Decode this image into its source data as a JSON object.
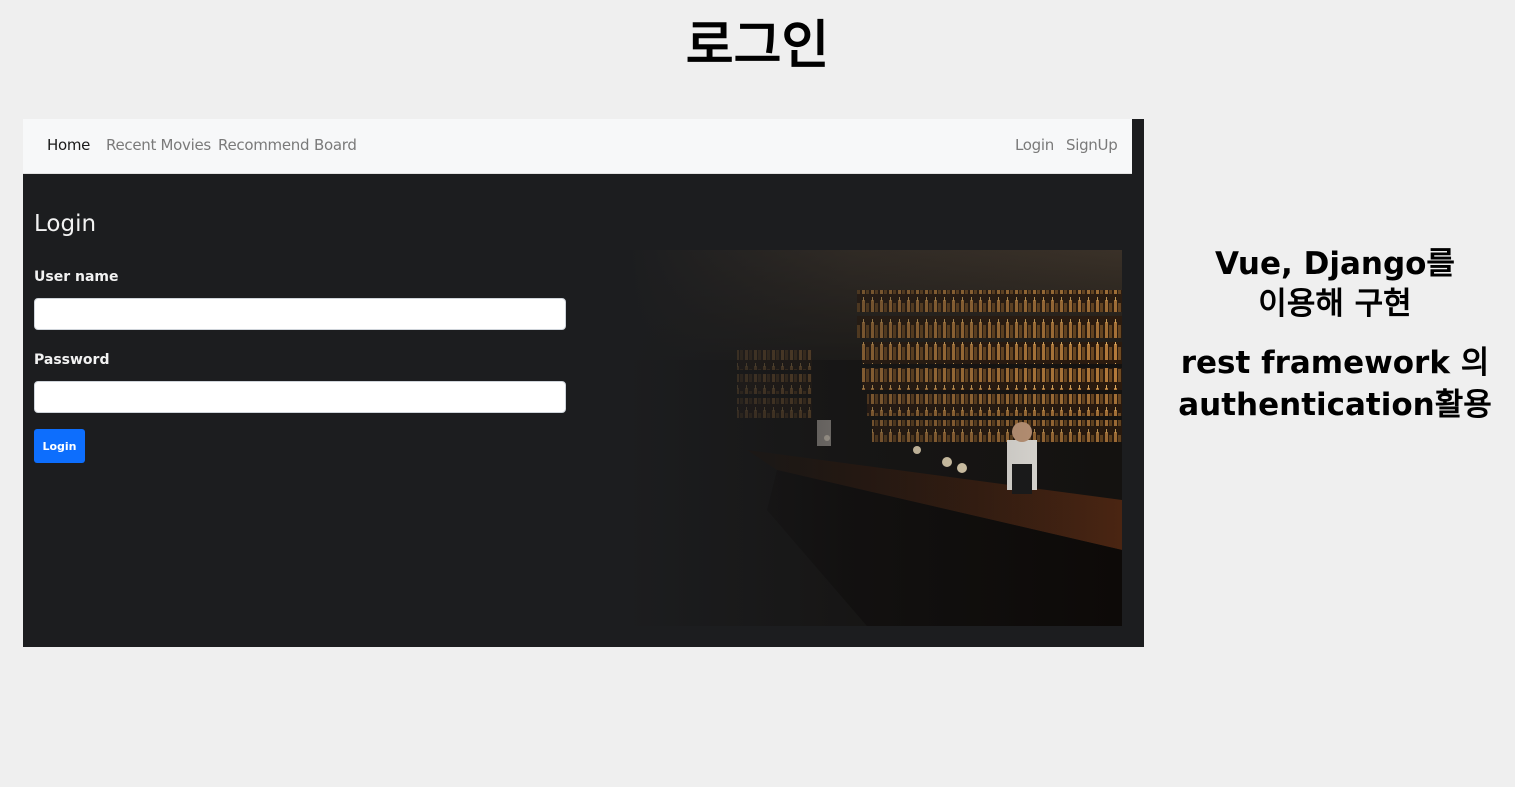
{
  "slide": {
    "title": "로그인",
    "note_line1": "Vue, Django를",
    "note_line2": "이용해 구현",
    "note_line3": "rest framework 의",
    "note_line4": "authentication활용"
  },
  "navbar": {
    "left_items": [
      "Home",
      "Recent Movies",
      "Recommend",
      "Board"
    ],
    "right_items": [
      "Login",
      "SignUp"
    ],
    "active": "Home"
  },
  "form": {
    "heading": "Login",
    "username_label": "User name",
    "username_value": "",
    "password_label": "Password",
    "password_value": "",
    "submit_label": "Login"
  },
  "image": {
    "description_icon": "bar-interior-photo"
  },
  "colors": {
    "page_bg": "#efefef",
    "app_bg": "#1c1d1f",
    "navbar_bg": "#f7f8f9",
    "primary_button": "#0d6efd"
  }
}
